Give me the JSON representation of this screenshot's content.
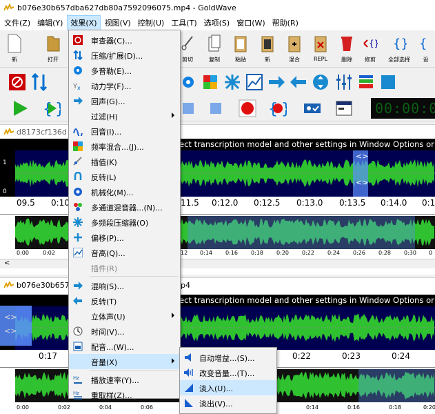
{
  "window": {
    "title": "b076e30b657dba627db80a7592096075.mp4 - GoldWave"
  },
  "menubar": [
    {
      "label": "文件(Z)"
    },
    {
      "label": "编辑(Y)"
    },
    {
      "label": "效果(X)"
    },
    {
      "label": "视图(V)"
    },
    {
      "label": "控制(U)"
    },
    {
      "label": "工具(T)"
    },
    {
      "label": "选项(S)"
    },
    {
      "label": "窗口(W)"
    },
    {
      "label": "帮助(R)"
    }
  ],
  "toolbar": {
    "buttons": [
      {
        "label": "新"
      },
      {
        "label": "打开"
      },
      {
        "label": "剪切"
      },
      {
        "label": "复制"
      },
      {
        "label": "粘贴"
      },
      {
        "label": "新"
      },
      {
        "label": "混合"
      },
      {
        "label": "REPL"
      },
      {
        "label": "删除"
      },
      {
        "label": "修剪"
      },
      {
        "label": "全部选择"
      },
      {
        "label": "设"
      }
    ]
  },
  "time_display": "00:00:0",
  "doc1": {
    "title": "d8173cf136d",
    "notice": "ect transcription model and other settings in Window Options or cl",
    "ruler": [
      "09.5",
      "0:10",
      "11.5",
      "0:12.0",
      "0:12.5",
      "0:13.0",
      "0:13.5",
      "0:14.0",
      "0:1"
    ],
    "overview_ruler": [
      "0:00",
      "0:02",
      "12",
      "0:14",
      "0:16",
      "0:18",
      "0:20",
      "0:22",
      "0:24",
      "0:26",
      "0:28",
      "0:30",
      "0"
    ],
    "channel_labels": [
      "1",
      "0"
    ]
  },
  "doc2": {
    "title": "b076e30b657",
    "title_suffix": "p4",
    "notice": "ect transcription model and other settings in Window Options or cl",
    "ruler": [
      "0:17",
      "0:22",
      "0:23",
      "0:24"
    ],
    "overview_ruler": [
      "0:00",
      "0:02",
      "0:04",
      "0:06",
      "0:14",
      "0:16",
      "0:18",
      "0:20"
    ]
  },
  "effects_menu": {
    "items": [
      {
        "label": "审查器(C)...",
        "icon": "inspector-icon"
      },
      {
        "label": "压缩/扩展(D)...",
        "icon": "compressor-icon"
      },
      {
        "label": "多普勒(E)...",
        "icon": "doppler-icon"
      },
      {
        "label": "动力学(F)...",
        "icon": "dynamics-icon"
      },
      {
        "label": "回声(G)...",
        "icon": "echo-icon"
      },
      {
        "label": "过滤(H)",
        "icon": "",
        "submenu": true
      },
      {
        "label": "回音(I)...",
        "icon": "flanger-icon"
      },
      {
        "label": "频率混合...(J)...",
        "icon": "mix-icon"
      },
      {
        "label": "插值(K)",
        "icon": "interpolate-icon"
      },
      {
        "label": "反转(L)",
        "icon": "invert-icon"
      },
      {
        "label": "机械化(M)...",
        "icon": "mechanize-icon"
      },
      {
        "label": "多通道混音器...(N)...",
        "icon": "channel-mixer-icon"
      },
      {
        "label": "多频段压缩器(O)",
        "icon": "multiband-icon"
      },
      {
        "label": "偏移(P)...",
        "icon": "offset-icon"
      },
      {
        "label": "音高(Q)...",
        "icon": "pitch-icon"
      },
      {
        "label": "插件(R)",
        "icon": "",
        "disabled": true
      },
      {
        "label": "混响(S)...",
        "icon": "reverb-icon"
      },
      {
        "label": "反转(T)",
        "icon": "reverse-icon"
      },
      {
        "label": "立体声(U)",
        "icon": "",
        "submenu": true
      },
      {
        "label": "时间(V)...",
        "icon": "clock-icon"
      },
      {
        "label": "配音...(W)...",
        "icon": "voiceover-icon"
      },
      {
        "label": "音量(X)",
        "icon": "",
        "submenu": true,
        "highlighted": true
      },
      {
        "label": "播放速率(Y)...",
        "icon": "playback-rate-icon"
      },
      {
        "label": "重取样(Z)...",
        "icon": "resample-icon"
      }
    ]
  },
  "volume_submenu": {
    "items": [
      {
        "label": "自动增益...(S)...",
        "icon": "auto-gain-icon"
      },
      {
        "label": "改变音量...(T)...",
        "icon": "change-volume-icon"
      },
      {
        "label": "淡入(U)...",
        "icon": "fade-in-icon",
        "highlighted": true
      },
      {
        "label": "淡出(V)...",
        "icon": "fade-out-icon"
      }
    ]
  },
  "colors": {
    "wave_green": "#2fc12f",
    "wave_bg": "#000050",
    "selection": "#6699ff",
    "menu_highlight": "#cce8ff"
  }
}
